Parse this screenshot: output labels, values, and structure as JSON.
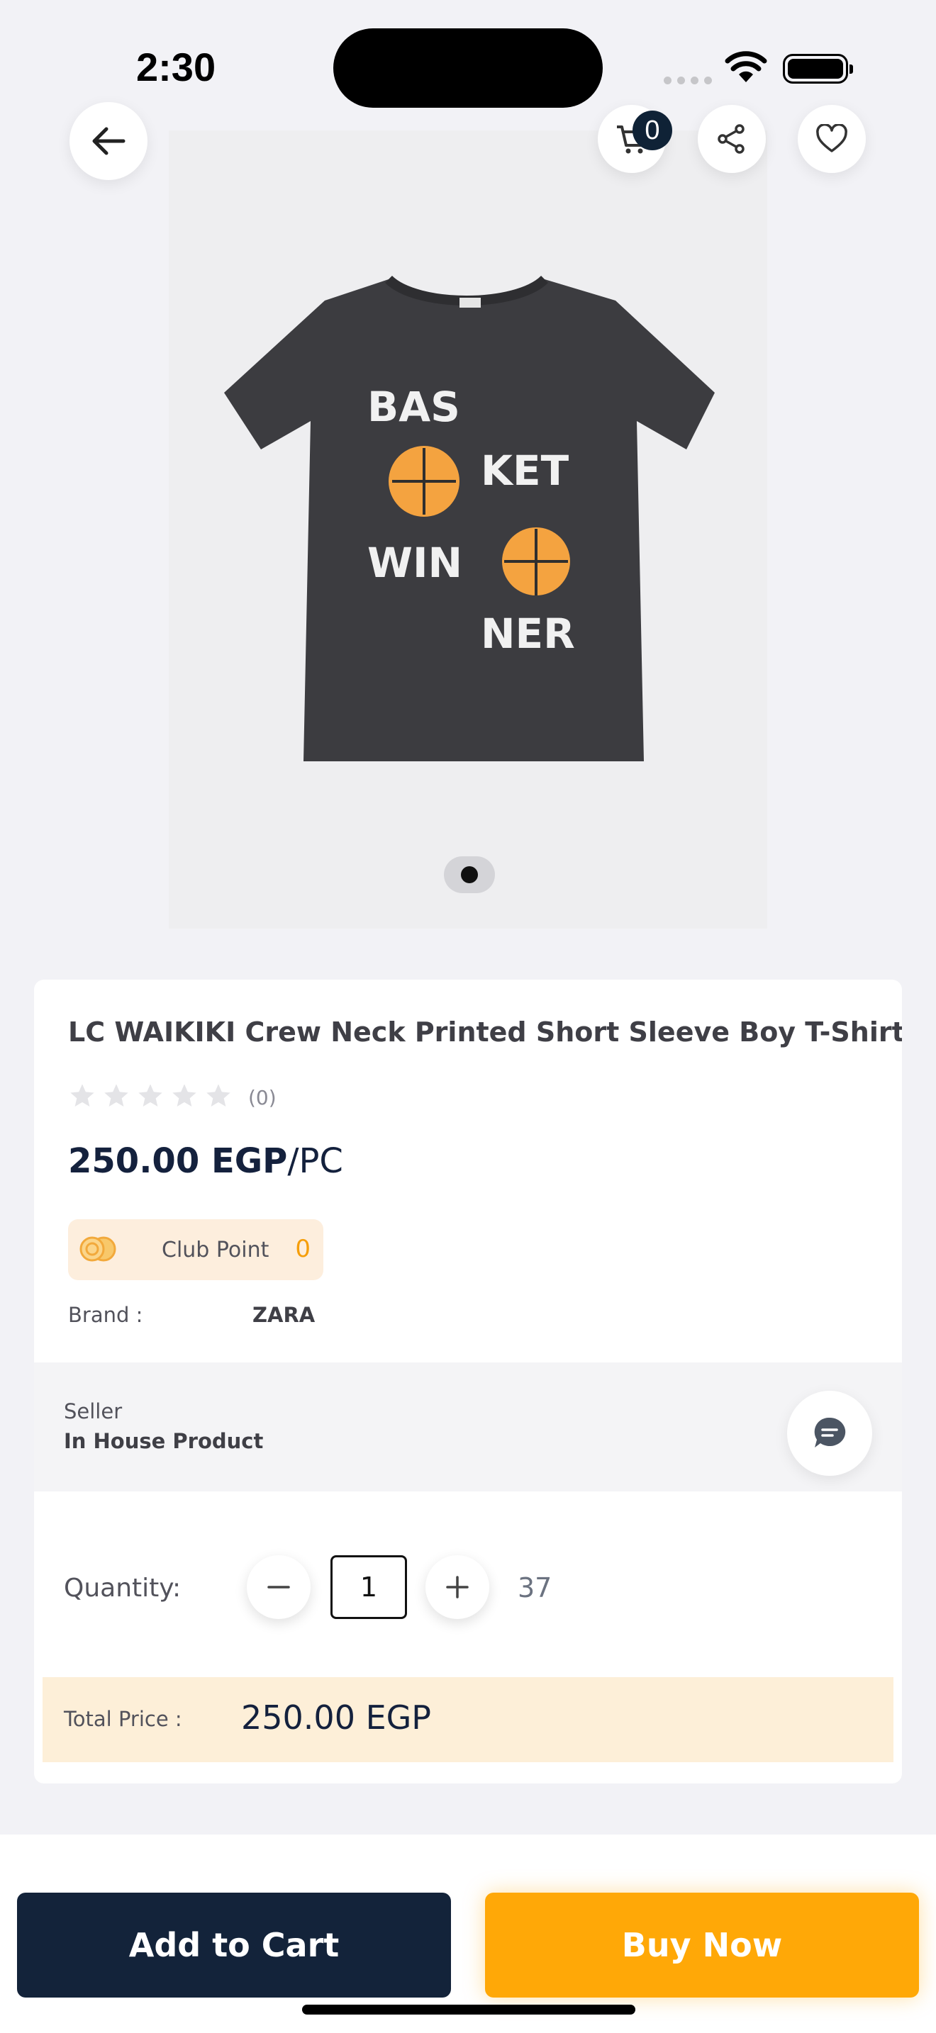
{
  "status_bar": {
    "time": "2:30"
  },
  "header": {
    "cart_count": "0"
  },
  "product": {
    "title": "LC WAIKIKI Crew Neck Printed Short Sleeve Boy T-Shirt",
    "rating_stars": 0,
    "review_count": "(0)",
    "price": "250.00 EGP",
    "unit": "/PC",
    "club_point_label": "Club Point",
    "club_point_value": "0",
    "brand_label": "Brand :",
    "brand_value": "ZARA",
    "image_print_text": [
      "BAS",
      "KET",
      "WIN",
      "NER"
    ]
  },
  "gallery": {
    "active_dot": 1,
    "dot_count": 1
  },
  "seller": {
    "label": "Seller",
    "name": "In House Product"
  },
  "quantity": {
    "label": "Quantity:",
    "value": "1",
    "stock": "37"
  },
  "total": {
    "label": "Total Price :",
    "value": "250.00 EGP"
  },
  "actions": {
    "add_to_cart": "Add to Cart",
    "buy_now": "Buy Now"
  },
  "colors": {
    "navy": "#13233a",
    "orange": "#ffa807",
    "club_bg": "#fdeedd",
    "total_bg": "#fdefd8"
  }
}
